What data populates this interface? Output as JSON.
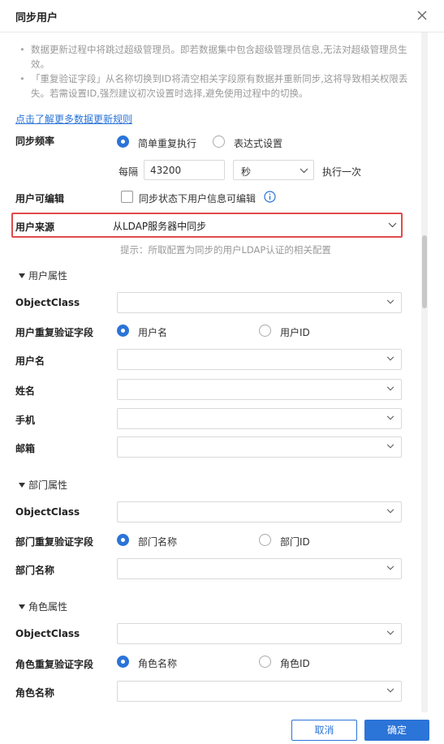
{
  "dialog": {
    "title": "同步用户"
  },
  "notes": [
    "数据更新过程中将跳过超级管理员。即若数据集中包含超级管理员信息,无法对超级管理员生效。",
    "「重复验证字段」从名称切换到ID将清空相关字段原有数据并重新同步,这将导致相关权限丢失。若需设置ID,强烈建议初次设置时选择,避免使用过程中的切换。"
  ],
  "learn_more_link": "点击了解更多数据更新规则",
  "sync_frequency": {
    "label": "同步频率",
    "option_simple": "简单重复执行",
    "option_expression": "表达式设置",
    "every_label": "每隔",
    "interval_value": "43200",
    "unit_value": "秒",
    "execute_label": "执行一次"
  },
  "user_editable": {
    "label": "用户可编辑",
    "checkbox_label": "同步状态下用户信息可编辑"
  },
  "user_source": {
    "label": "用户来源",
    "value": "从LDAP服务器中同步",
    "hint": "提示：所取配置为同步的用户LDAP认证的相关配置"
  },
  "user_attrs": {
    "section": "用户属性",
    "objectclass_label": "ObjectClass",
    "dedup_label": "用户重复验证字段",
    "dedup_option_name": "用户名",
    "dedup_option_id": "用户ID",
    "username_label": "用户名",
    "fullname_label": "姓名",
    "phone_label": "手机",
    "email_label": "邮箱"
  },
  "dept_attrs": {
    "section": "部门属性",
    "objectclass_label": "ObjectClass",
    "dedup_label": "部门重复验证字段",
    "dedup_option_name": "部门名称",
    "dedup_option_id": "部门ID",
    "name_label": "部门名称"
  },
  "role_attrs": {
    "section": "角色属性",
    "objectclass_label": "ObjectClass",
    "dedup_label": "角色重复验证字段",
    "dedup_option_name": "角色名称",
    "dedup_option_id": "角色ID",
    "name_label": "角色名称"
  },
  "footer": {
    "cancel": "取消",
    "ok": "确定"
  },
  "colors": {
    "accent": "#2b74d8",
    "highlight": "#e04b4b"
  }
}
